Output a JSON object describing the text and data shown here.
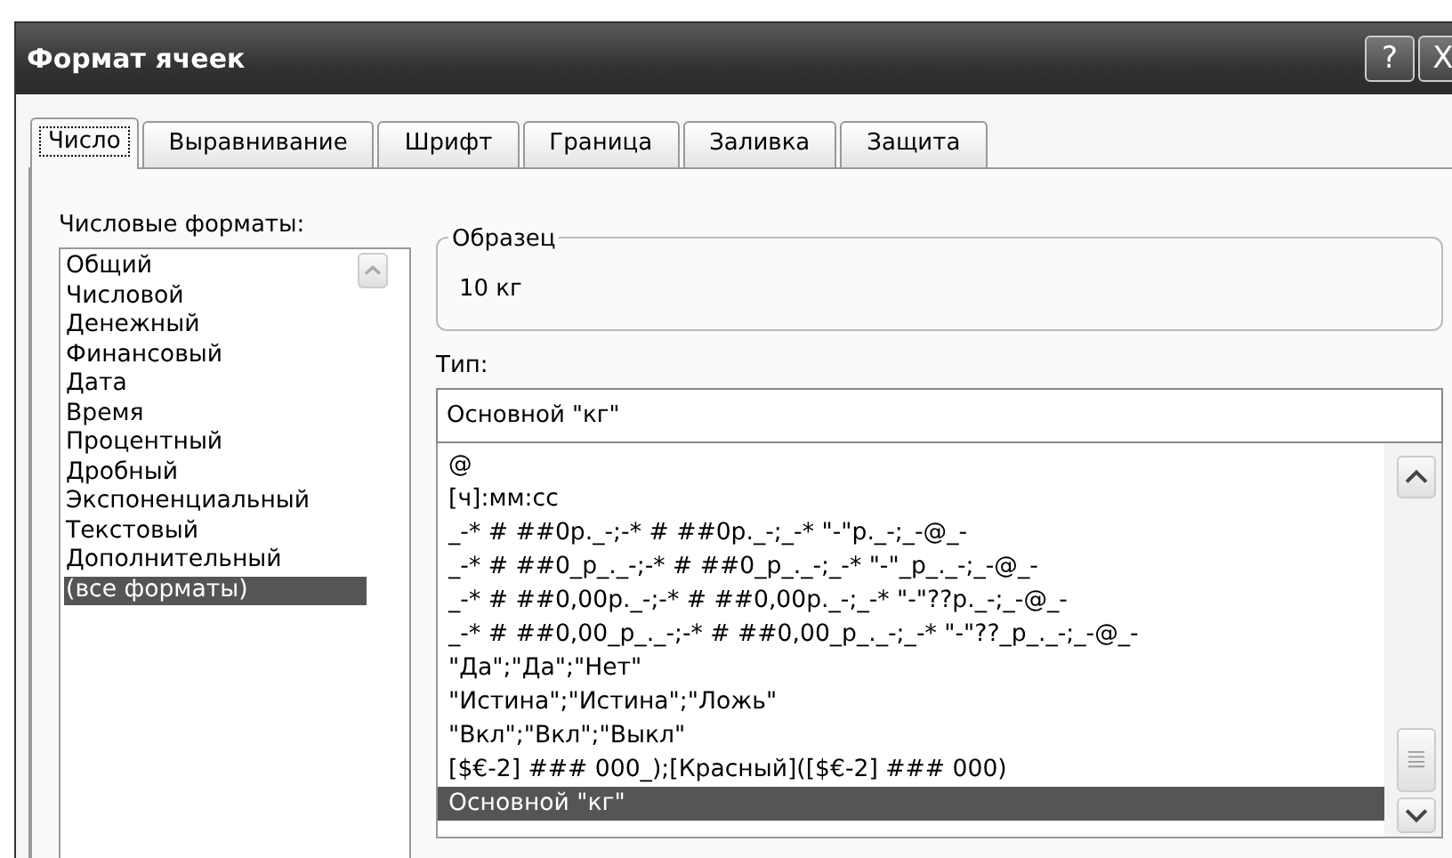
{
  "window": {
    "title": "Формат ячеек"
  },
  "title_buttons": [
    {
      "label": "?"
    },
    {
      "label": "X"
    }
  ],
  "tabs": [
    {
      "label": "Число",
      "selected": true
    },
    {
      "label": "Выравнивание",
      "selected": false
    },
    {
      "label": "Шрифт",
      "selected": false
    },
    {
      "label": "Граница",
      "selected": false
    },
    {
      "label": "Заливка",
      "selected": false
    },
    {
      "label": "Защита",
      "selected": false
    }
  ],
  "categories": {
    "label": "Числовые форматы:",
    "items": [
      {
        "label": "Общий",
        "selected": false
      },
      {
        "label": "Числовой",
        "selected": false
      },
      {
        "label": "Денежный",
        "selected": false
      },
      {
        "label": "Финансовый",
        "selected": false
      },
      {
        "label": "Дата",
        "selected": false
      },
      {
        "label": "Время",
        "selected": false
      },
      {
        "label": "Процентный",
        "selected": false
      },
      {
        "label": "Дробный",
        "selected": false
      },
      {
        "label": "Экспоненциальный",
        "selected": false
      },
      {
        "label": "Текстовый",
        "selected": false
      },
      {
        "label": "Дополнительный",
        "selected": false
      },
      {
        "label": "(все форматы)",
        "selected": true
      }
    ]
  },
  "sample": {
    "label": "Образец",
    "value": "10 кг"
  },
  "type": {
    "label": "Тип:",
    "value": "Основной \"кг\"",
    "items": [
      {
        "label": "@",
        "selected": false
      },
      {
        "label": "[ч]:мм:сс",
        "selected": false
      },
      {
        "label": "_-* # ##0р._-;-* # ##0р._-;_-* \"-\"р._-;_-@_-",
        "selected": false
      },
      {
        "label": "_-* # ##0_р_._-;-* # ##0_р_._-;_-* \"-\"_р_._-;_-@_-",
        "selected": false
      },
      {
        "label": "_-* # ##0,00р._-;-* # ##0,00р._-;_-* \"-\"??р._-;_-@_-",
        "selected": false
      },
      {
        "label": "_-* # ##0,00_р_._-;-* # ##0,00_р_._-;_-* \"-\"??_р_._-;_-@_-",
        "selected": false
      },
      {
        "label": "\"Да\";\"Да\";\"Нет\"",
        "selected": false
      },
      {
        "label": "\"Истина\";\"Истина\";\"Ложь\"",
        "selected": false
      },
      {
        "label": "\"Вкл\";\"Вкл\";\"Выкл\"",
        "selected": false
      },
      {
        "label": "[$€-2] ### 000_);[Красный]([$€-2] ### 000)",
        "selected": false
      },
      {
        "label": "Основной \"кг\"",
        "selected": true
      }
    ]
  }
}
